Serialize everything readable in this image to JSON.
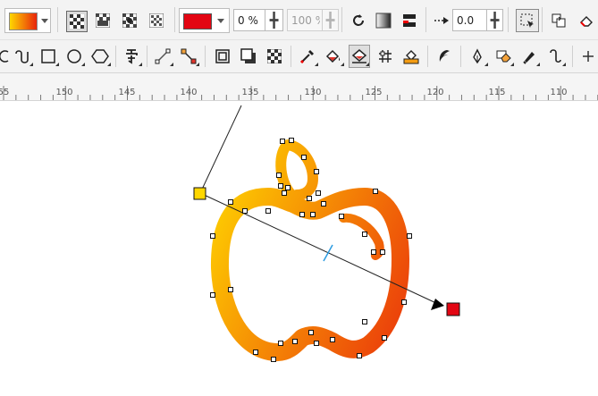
{
  "toolbar_top": {
    "fill_swatch_start": "#FFD700",
    "fill_swatch_end": "#E8260C",
    "transparency_color": "#E30613",
    "transparency_value": "0 %",
    "opacity_value": "100 %",
    "offset_value": "0.0"
  },
  "icons_top": [
    "fill-picker-icon",
    "checker-uniform-icon",
    "checker-linear-icon",
    "checker-radial-icon",
    "checker-pattern-icon",
    "refresh-icon",
    "gradient-icon",
    "align-icon",
    "arrow-offset-icon",
    "select-icon",
    "copy-properties-icon",
    "erase-icon"
  ],
  "icons_tools": [
    "spiral-icon",
    "rectangle-icon",
    "ellipse-icon",
    "polygon-icon",
    "text-icon",
    "line-icon",
    "connector-icon",
    "frame-icon",
    "shadow-icon",
    "transparency-icon",
    "eyedropper-icon",
    "fill-bucket-icon",
    "interactive-fill-icon",
    "mesh-icon",
    "smart-fill-icon",
    "artistic-media-icon",
    "pen-icon",
    "eraser-icon",
    "smudge-icon",
    "add-icon"
  ],
  "ruler": {
    "labels": [
      "55",
      "150",
      "145",
      "140",
      "135",
      "130",
      "125",
      "120",
      "115",
      "110"
    ]
  },
  "colors": {
    "gradient_start": "#FFD700",
    "gradient_end": "#E8260C",
    "node_start_color": "#FFD700",
    "node_end_color": "#E30613",
    "midpoint_color": "#2B9BE0"
  }
}
